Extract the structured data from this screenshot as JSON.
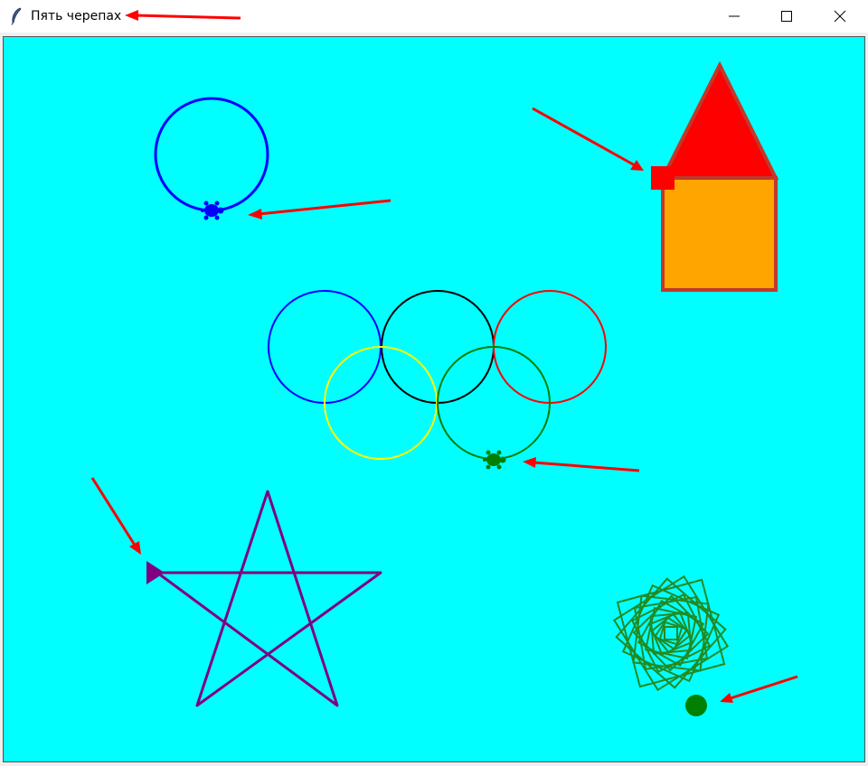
{
  "window": {
    "title": "Пять черепах",
    "icon": "feather-icon",
    "controls": [
      "minimize-icon",
      "maximize-icon",
      "close-icon"
    ]
  },
  "canvas": {
    "background": "#00ffff"
  },
  "colors": {
    "annotation_arrow": "#ff0000",
    "circle_turtle": "#0000ff",
    "house_wall": "#ffa500",
    "house_roof": "#ff0000",
    "house_outline": "#c0392b",
    "rings": [
      "#0000ff",
      "#000000",
      "#ff0000",
      "#ffff00",
      "#008000"
    ],
    "star": "#800080",
    "spiral": "#228b22",
    "spiral_turtle": "#008000"
  },
  "turtles": [
    {
      "name": "circle-turtle",
      "shape": "turtle",
      "color": "#0000ff"
    },
    {
      "name": "house-turtle",
      "shape": "square",
      "color": "#ff0000"
    },
    {
      "name": "rings-turtle",
      "shape": "turtle",
      "color": "#008000"
    },
    {
      "name": "star-turtle",
      "shape": "triangle",
      "color": "#800080"
    },
    {
      "name": "spiral-turtle",
      "shape": "circle",
      "color": "#008000"
    }
  ]
}
